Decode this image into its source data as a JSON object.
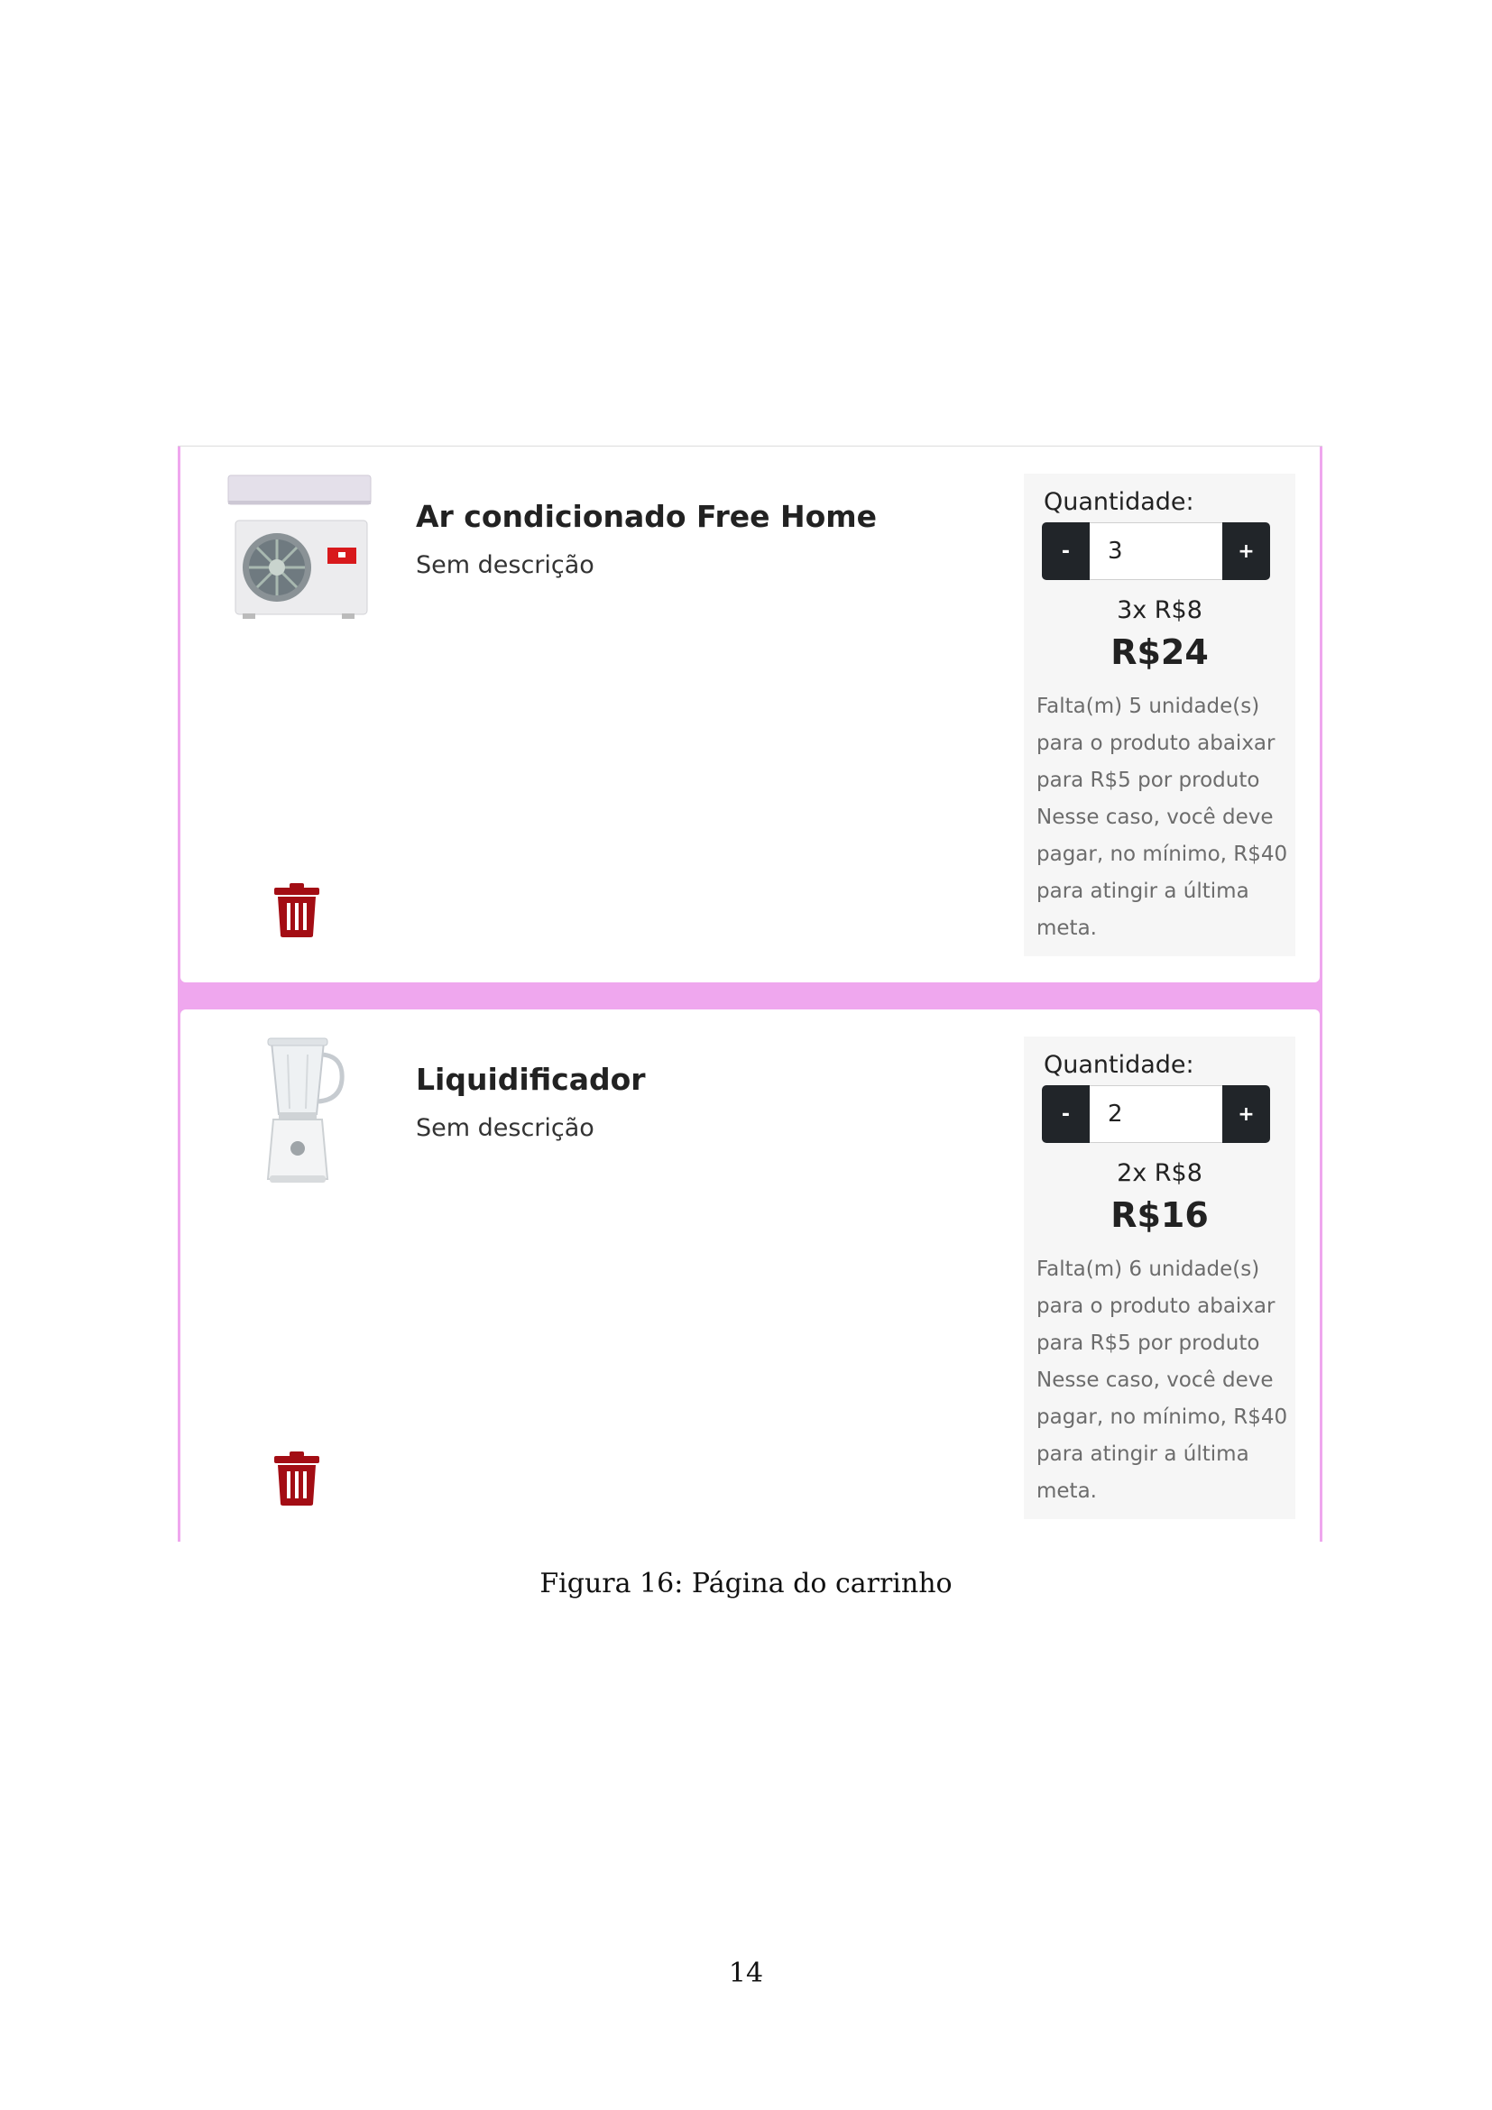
{
  "cart": {
    "items": [
      {
        "name": "Ar condicionado Free Home",
        "description": "Sem descrição",
        "image_icon": "air-conditioner-image",
        "delete_icon": "trash-icon",
        "quantity_label": "Quantidade:",
        "minus_label": "-",
        "plus_label": "+",
        "quantity": "3",
        "unit_price_line": "3x R$8",
        "total": "R$24",
        "note_lines": [
          "Falta(m) 5 unidade(s)",
          "para o produto abaixar",
          "para R$5 por produto",
          "Nesse caso, você deve",
          "pagar, no mínimo, R$40",
          "para atingir a última",
          "meta."
        ]
      },
      {
        "name": "Liquidificador",
        "description": "Sem descrição",
        "image_icon": "blender-image",
        "delete_icon": "trash-icon",
        "quantity_label": "Quantidade:",
        "minus_label": "-",
        "plus_label": "+",
        "quantity": "2",
        "unit_price_line": "2x R$8",
        "total": "R$16",
        "note_lines": [
          "Falta(m) 6 unidade(s)",
          "para o produto abaixar",
          "para R$5 por produto",
          "Nesse caso, você deve",
          "pagar, no mínimo, R$40",
          "para atingir a última",
          "meta."
        ]
      }
    ]
  },
  "colors": {
    "page_background": "#efa7ee",
    "card_background": "#ffffff",
    "button_dark": "#212529",
    "trash_red": "#a30d14",
    "summary_background": "#f6f6f6"
  },
  "caption": "Figura 16: Página do carrinho",
  "page_number": "14"
}
